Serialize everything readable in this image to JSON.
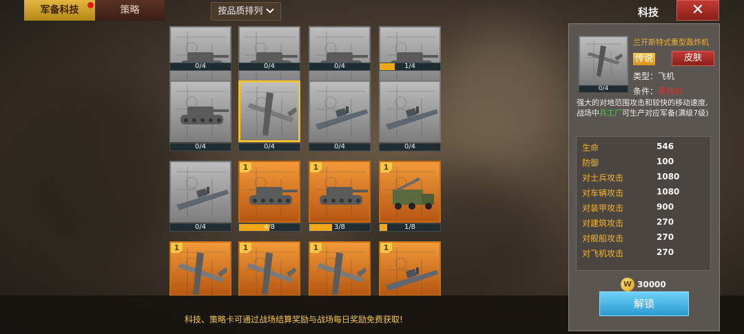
{
  "tabs": {
    "armory": "军备科技",
    "strategy": "策略"
  },
  "sort_label": "按品质排列",
  "title": "科技",
  "close_symbol": "✕",
  "grid": [
    {
      "name": "tank-card-1",
      "kind": "tank",
      "progress": "0/4",
      "level": null,
      "orange": false,
      "fill": 0
    },
    {
      "name": "tank-card-2",
      "kind": "tank",
      "progress": "0/4",
      "level": null,
      "orange": false,
      "fill": 0
    },
    {
      "name": "tank-card-3",
      "kind": "tank",
      "progress": "0/4",
      "level": null,
      "orange": false,
      "fill": 0
    },
    {
      "name": "tank-card-4",
      "kind": "tank",
      "progress": "1/4",
      "level": null,
      "orange": false,
      "fill": 0.25
    },
    {
      "name": "tank-card-5",
      "kind": "tank",
      "progress": "0/4",
      "level": null,
      "orange": false,
      "fill": 0
    },
    {
      "name": "bomber-card-selected",
      "kind": "plane",
      "progress": "0/4",
      "level": null,
      "orange": false,
      "fill": 0,
      "selected": true
    },
    {
      "name": "ship-card-1",
      "kind": "ship",
      "progress": "0/4",
      "level": null,
      "orange": false,
      "fill": 0
    },
    {
      "name": "ship-card-2",
      "kind": "ship",
      "progress": "0/4",
      "level": null,
      "orange": false,
      "fill": 0
    },
    {
      "name": "ship-card-3",
      "kind": "ship",
      "progress": "0/4",
      "level": null,
      "orange": false,
      "fill": 0
    },
    {
      "name": "tank-card-6",
      "kind": "tank",
      "progress": "4/8",
      "level": "1",
      "orange": true,
      "fill": 0.5
    },
    {
      "name": "tank-card-7",
      "kind": "tank",
      "progress": "3/8",
      "level": "1",
      "orange": true,
      "fill": 0.375
    },
    {
      "name": "truck-card",
      "kind": "truck",
      "progress": "1/8",
      "level": "1",
      "orange": true,
      "fill": 0.125
    },
    {
      "name": "plane-card-1",
      "kind": "plane",
      "progress": "",
      "level": "1",
      "orange": true,
      "fill": 0
    },
    {
      "name": "plane-card-2",
      "kind": "plane",
      "progress": "",
      "level": "1",
      "orange": true,
      "fill": 0
    },
    {
      "name": "plane-card-3",
      "kind": "plane",
      "progress": "",
      "level": "1",
      "orange": true,
      "fill": 0
    },
    {
      "name": "ship-card-4",
      "kind": "ship",
      "progress": "",
      "level": "1",
      "orange": true,
      "fill": 0
    }
  ],
  "detail": {
    "name": "兰开斯特式重型轰炸机",
    "progress": "0/4",
    "rarity": "传说",
    "skin_button": "皮肤",
    "type_label": "类型：",
    "type_value": "飞机",
    "condition_label": "条件：",
    "condition_value": "黑铁III",
    "desc_before": "强大的对地范围攻击和较快的移动速度,战场中",
    "desc_highlight": "兵工厂",
    "desc_after": "可生产对应军备(满级7级)",
    "stats": [
      {
        "label": "生命",
        "value": "546"
      },
      {
        "label": "防御",
        "value": "100"
      },
      {
        "label": "对士兵攻击",
        "value": "1080"
      },
      {
        "label": "对车辆攻击",
        "value": "1080"
      },
      {
        "label": "对装甲攻击",
        "value": "900"
      },
      {
        "label": "对建筑攻击",
        "value": "270"
      },
      {
        "label": "对舰船攻击",
        "value": "270"
      },
      {
        "label": "对飞机攻击",
        "value": "270"
      }
    ],
    "coin_symbol": "W",
    "cost": "30000",
    "unlock_button": "解锁"
  },
  "tip": "科技、策略卡可通过战场结算奖励与战场每日奖励免费获取!"
}
